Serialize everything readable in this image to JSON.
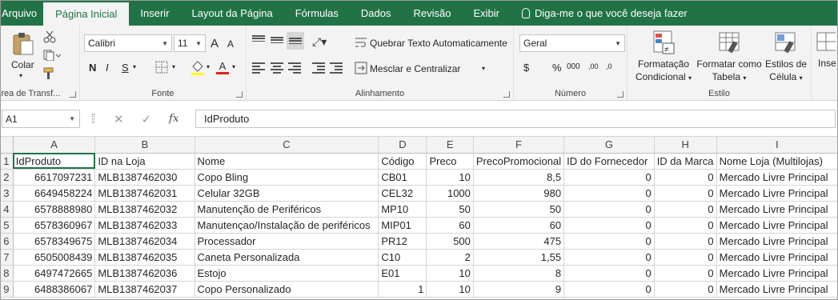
{
  "tabs": [
    "Arquivo",
    "Página Inicial",
    "Inserir",
    "Layout da Página",
    "Fórmulas",
    "Dados",
    "Revisão",
    "Exibir"
  ],
  "tell_me": "Diga-me o que você deseja fazer",
  "ribbon": {
    "clipboard": {
      "paste": "Colar",
      "label": "Área de Transf..."
    },
    "font": {
      "name": "Calibri",
      "size": "11",
      "label": "Fonte",
      "bold": "N",
      "italic": "I",
      "underline": "S",
      "grow": "A",
      "shrink": "A",
      "color_letter": "A"
    },
    "alignment": {
      "wrap": "Quebrar Texto Automaticamente",
      "merge": "Mesclar e Centralizar",
      "label": "Alinhamento"
    },
    "number": {
      "format": "Geral",
      "label": "Número",
      "currency": "$",
      "percent": "%",
      "thousands": "000",
      "dec_more": ",00",
      "dec_less": ",0"
    },
    "styles": {
      "conditional": [
        "Formatação",
        "Condicional"
      ],
      "table": [
        "Formatar como",
        "Tabela"
      ],
      "cell": [
        "Estilos de",
        "Célula"
      ],
      "label": "Estilo"
    },
    "insert_partial": "Inse"
  },
  "formula_bar": {
    "name_box": "A1",
    "cancel": "✕",
    "enter": "✓",
    "fx": "fx",
    "value": "IdProduto"
  },
  "columns": [
    "A",
    "B",
    "C",
    "D",
    "E",
    "F",
    "G",
    "H",
    "I"
  ],
  "rows": [
    {
      "n": "1",
      "cells": [
        "IdProduto",
        "ID na Loja",
        "Nome",
        "Código",
        "Preco",
        "PrecoPromocional",
        "ID do Fornecedor",
        "ID da Marca",
        "Nome Loja (Multilojas)"
      ]
    },
    {
      "n": "2",
      "cells": [
        "6617097231",
        "MLB1387462030",
        "Copo Bling",
        "CB01",
        "10",
        "8,5",
        "0",
        "0",
        "Mercado Livre Principal"
      ]
    },
    {
      "n": "3",
      "cells": [
        "6649458224",
        "MLB1387462031",
        "Celular 32GB",
        "CEL32",
        "1000",
        "980",
        "0",
        "0",
        "Mercado Livre Principal"
      ]
    },
    {
      "n": "4",
      "cells": [
        "6578888980",
        "MLB1387462032",
        "Manutenção de Periféricos",
        "MP10",
        "50",
        "50",
        "0",
        "0",
        "Mercado Livre Principal"
      ]
    },
    {
      "n": "5",
      "cells": [
        "6578360967",
        "MLB1387462033",
        "Manutençao/Instalação de periféricos",
        "MIP01",
        "60",
        "60",
        "0",
        "0",
        "Mercado Livre Principal"
      ]
    },
    {
      "n": "6",
      "cells": [
        "6578349675",
        "MLB1387462034",
        "Processador",
        "PR12",
        "500",
        "475",
        "0",
        "0",
        "Mercado Livre Principal"
      ]
    },
    {
      "n": "7",
      "cells": [
        "6505008439",
        "MLB1387462035",
        "Caneta Personalizada",
        "C10",
        "2",
        "1,55",
        "0",
        "0",
        "Mercado Livre Principal"
      ]
    },
    {
      "n": "8",
      "cells": [
        "6497472665",
        "MLB1387462036",
        "Estojo",
        "E01",
        "10",
        "8",
        "0",
        "0",
        "Mercado Livre Principal"
      ]
    },
    {
      "n": "9",
      "cells": [
        "6488386067",
        "MLB1387462037",
        "Copo Personalizado",
        "1",
        "10",
        "9",
        "0",
        "0",
        "Mercado Livre Principal"
      ]
    }
  ],
  "colors": {
    "accent": "#217346",
    "ribbon_bg": "#f3f3f3",
    "grid_line": "#d4d4d4"
  }
}
